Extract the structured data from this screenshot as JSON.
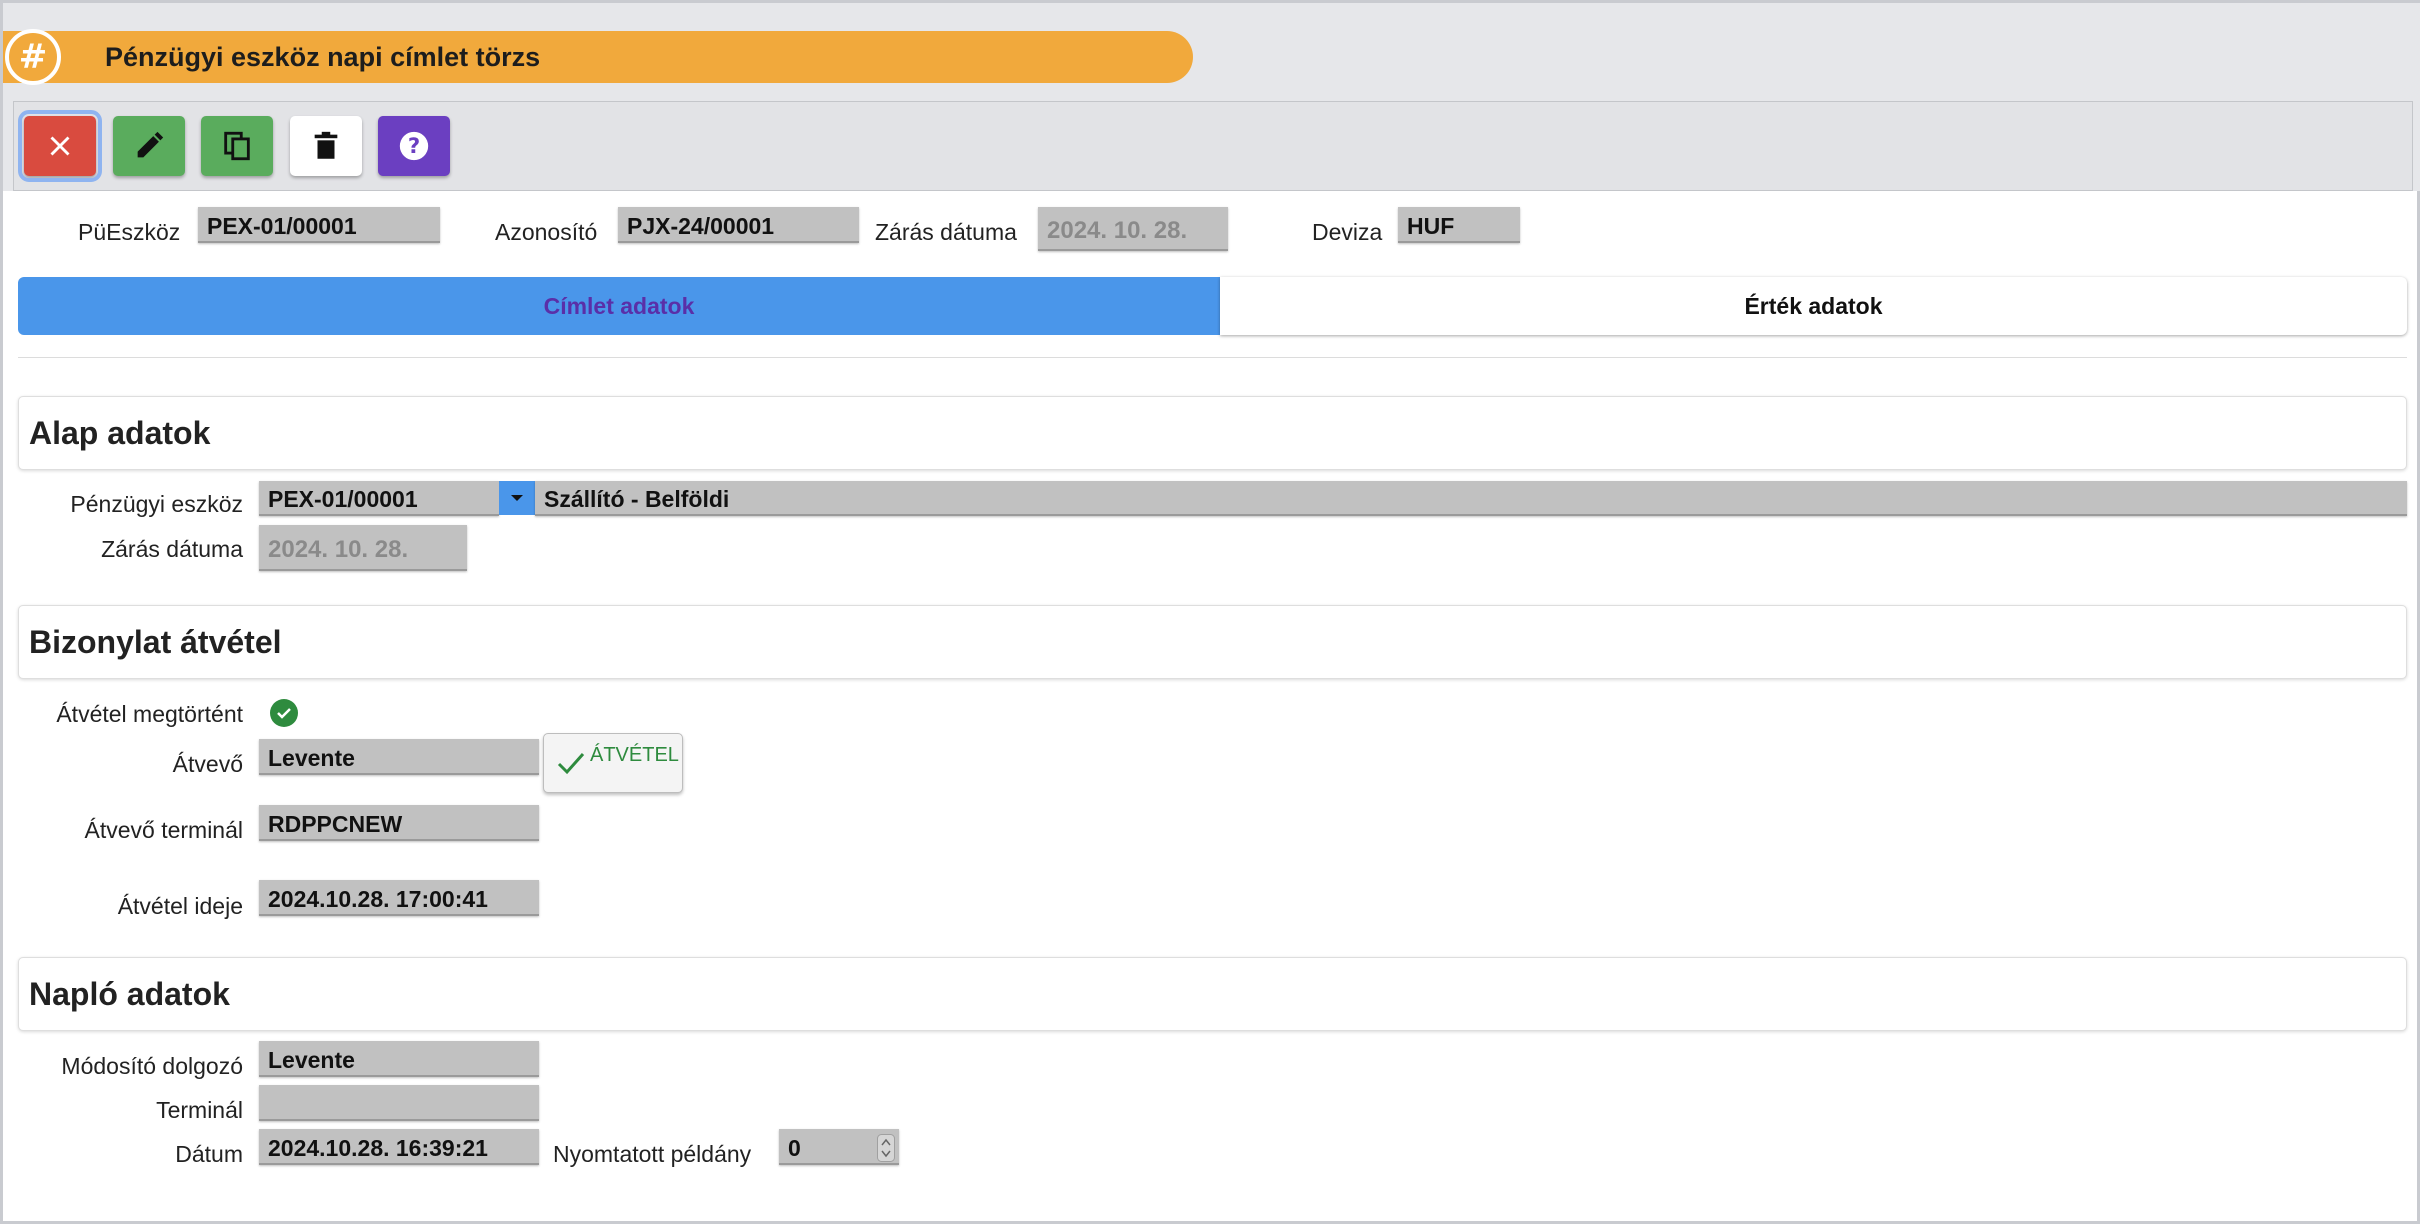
{
  "window": {
    "title": "Pénzügyi eszköz napi címlet törzs",
    "title_icon": "hash-icon"
  },
  "toolbar": {
    "buttons": [
      {
        "name": "close",
        "icon": "close-icon",
        "color": "#d94b3f"
      },
      {
        "name": "edit",
        "icon": "pencil-icon",
        "color": "#5aac5d"
      },
      {
        "name": "copy",
        "icon": "copy-icon",
        "color": "#5aac5d"
      },
      {
        "name": "delete",
        "icon": "trash-icon",
        "color": "#ffffff"
      },
      {
        "name": "help",
        "icon": "help-icon",
        "color": "#6b3fc1"
      }
    ]
  },
  "header_fields": {
    "pueszkoz_label": "PüEszköz",
    "pueszkoz_value": "PEX-01/00001",
    "azonosito_label": "Azonosító",
    "azonosito_value": "PJX-24/00001",
    "zaras_datuma_label": "Zárás dátuma",
    "zaras_datuma_value": "2024. 10. 28.",
    "deviza_label": "Deviza",
    "deviza_value": "HUF"
  },
  "tabs": [
    {
      "label": "Címlet adatok",
      "active": true
    },
    {
      "label": "Érték adatok",
      "active": false
    }
  ],
  "sections": {
    "alap": {
      "title": "Alap adatok",
      "penzugyi_eszkoz_label": "Pénzügyi eszköz",
      "penzugyi_eszkoz_value": "PEX-01/00001",
      "penzugyi_eszkoz_desc": "Szállító - Belföldi",
      "zaras_datuma_label": "Zárás dátuma",
      "zaras_datuma_value": "2024. 10. 28."
    },
    "bizonylat": {
      "title": "Bizonylat átvétel",
      "atvetel_megtortent_label": "Átvétel megtörtént",
      "atvetel_megtortent_value": true,
      "atvevo_label": "Átvevő",
      "atvevo_value": "Levente",
      "atvetel_button_label": "ÁTVÉTEL",
      "atvevo_terminal_label": "Átvevő terminál",
      "atvevo_terminal_value": "RDPPCNEW",
      "atvetel_ideje_label": "Átvétel ideje",
      "atvetel_ideje_value": "2024.10.28. 17:00:41"
    },
    "naplo": {
      "title": "Napló adatok",
      "modosito_label": "Módosító dolgozó",
      "modosito_value": "Levente",
      "terminal_label": "Terminál",
      "terminal_value": "",
      "datum_label": "Dátum",
      "datum_value": "2024.10.28. 16:39:21",
      "nyomtatott_label": "Nyomtatott példány",
      "nyomtatott_value": "0"
    }
  },
  "colors": {
    "accent": "#f1a93c",
    "tab_active": "#4a96ea",
    "success": "#2e8b3e"
  }
}
